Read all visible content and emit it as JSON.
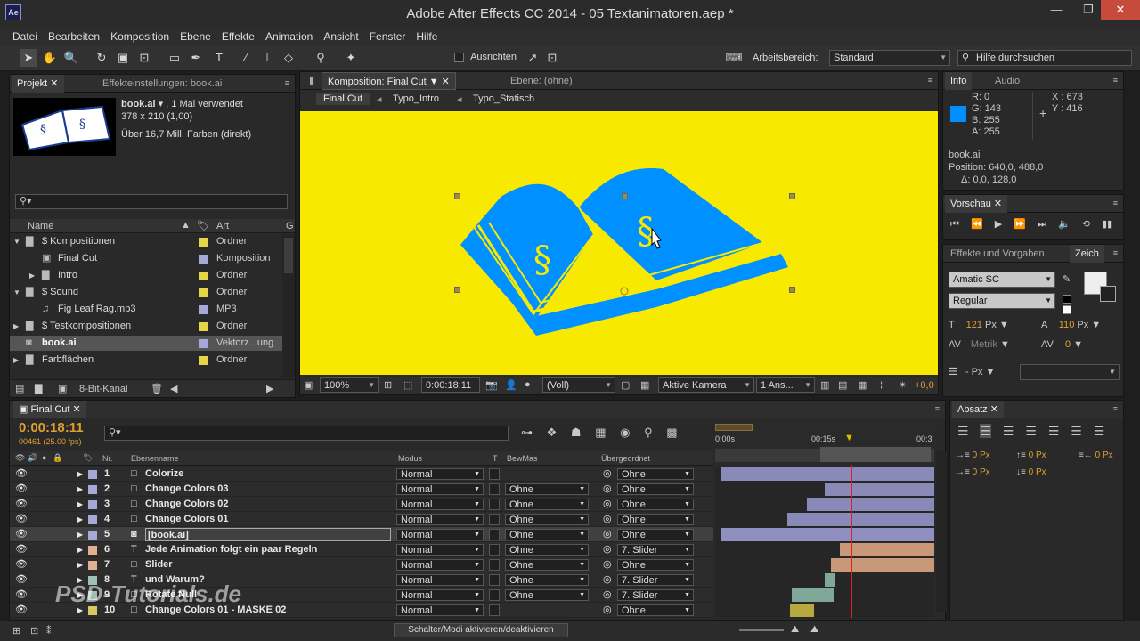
{
  "app": {
    "title": "Adobe After Effects CC 2014 - 05 Textanimatoren.aep *",
    "icon_text": "Ae"
  },
  "menu": [
    "Datei",
    "Bearbeiten",
    "Komposition",
    "Ebene",
    "Effekte",
    "Animation",
    "Ansicht",
    "Fenster",
    "Hilfe"
  ],
  "toolbar": {
    "snap_label": "Ausrichten",
    "workspace_label": "Arbeitsbereich:",
    "workspace_value": "Standard",
    "help_placeholder": "Hilfe durchsuchen"
  },
  "project": {
    "tab": "Projekt",
    "tab2": "Effekteinstellungen: book.ai",
    "item_name": "book.ai",
    "item_usage": ", 1 Mal verwendet",
    "item_size": "378 x 210 (1,00)",
    "item_colors": "Über 16,7 Mill. Farben (direkt)",
    "col_name": "Name",
    "col_type": "Art",
    "items": [
      {
        "indent": 0,
        "arrow": "▼",
        "icon": "folder",
        "name": "$ Kompositionen",
        "type": "Ordner",
        "sel": false
      },
      {
        "indent": 1,
        "arrow": "",
        "icon": "comp",
        "name": "Final Cut",
        "type": "Komposition",
        "sel": false
      },
      {
        "indent": 1,
        "arrow": "▶",
        "icon": "folder",
        "name": "Intro",
        "type": "Ordner",
        "sel": false
      },
      {
        "indent": 0,
        "arrow": "▼",
        "icon": "folder",
        "name": "$ Sound",
        "type": "Ordner",
        "sel": false
      },
      {
        "indent": 1,
        "arrow": "",
        "icon": "audio",
        "name": "Fig Leaf Rag.mp3",
        "type": "MP3",
        "sel": false
      },
      {
        "indent": 0,
        "arrow": "▶",
        "icon": "folder",
        "name": "$ Testkompositionen",
        "type": "Ordner",
        "sel": false
      },
      {
        "indent": 0,
        "arrow": "",
        "icon": "ai",
        "name": "book.ai",
        "type": "Vektorz...ung",
        "sel": true
      },
      {
        "indent": 0,
        "arrow": "▶",
        "icon": "folder",
        "name": "Farbflächen",
        "type": "Ordner",
        "sel": false
      }
    ],
    "bit_depth": "8-Bit-Kanal"
  },
  "composition": {
    "tab": "Komposition: Final Cut",
    "tab2": "Ebene: (ohne)",
    "breadcrumbs": [
      "Final Cut",
      "Typo_Intro",
      "Typo_Statisch"
    ],
    "zoom": "100%",
    "timecode": "0:00:18:11",
    "resolution": "(Voll)",
    "camera": "Aktive Kamera",
    "views": "1 Ans...",
    "exposure": "+0,0",
    "bg_color": "#f8e900"
  },
  "info": {
    "tab": "Info",
    "tab2": "Audio",
    "r": "R:  0",
    "g": "G:  143",
    "b": "B:  255",
    "a": "A:  255",
    "x": "X : 673",
    "y": "Y : 416",
    "layer": "book.ai",
    "position": "Position: 640,0, 488,0",
    "delta": "Δ: 0,0, 128,0",
    "swatch": "#008fff"
  },
  "preview": {
    "tab": "Vorschau"
  },
  "effects": {
    "tab": "Effekte und Vorgaben",
    "tab2": "Zeich"
  },
  "character": {
    "font": "Amatic SC",
    "style": "Regular",
    "size": "121",
    "leading": "110",
    "unit": "Px",
    "kerning": "Metrik",
    "tracking": "0",
    "stroke_unit": "- Px"
  },
  "paragraph": {
    "tab": "Absatz",
    "values": [
      "0 Px",
      "0 Px",
      "0 Px",
      "0 Px",
      "0 Px"
    ]
  },
  "timeline": {
    "tab": "Final Cut",
    "timecode": "0:00:18:11",
    "frames": "00461 (25.00 fps)",
    "col_nr": "Nr.",
    "col_name": "Ebenenname",
    "col_mode": "Modus",
    "col_t": "T",
    "col_trkmat": "BewMas",
    "col_parent": "Übergeordnet",
    "ruler": [
      "0:00s",
      "00:15s",
      "00:3"
    ],
    "switch_label": "Schalter/Modi aktivieren/deaktivieren",
    "layers": [
      {
        "nr": "1",
        "label": "#a8a8d8",
        "icon": "solid",
        "name": "Colorize",
        "mode": "Normal",
        "trkmat": "",
        "parent": "Ohne",
        "sel": false,
        "bar_start": 0.03,
        "bar_color": "#8a8ab8"
      },
      {
        "nr": "2",
        "label": "#a8a8d8",
        "icon": "solid",
        "name": "Change Colors 03",
        "mode": "Normal",
        "trkmat": "Ohne",
        "parent": "Ohne",
        "sel": false,
        "bar_start": 0.5,
        "bar_color": "#8a8ab8"
      },
      {
        "nr": "3",
        "label": "#a8a8d8",
        "icon": "solid",
        "name": "Change Colors 02",
        "mode": "Normal",
        "trkmat": "Ohne",
        "parent": "Ohne",
        "sel": false,
        "bar_start": 0.42,
        "bar_color": "#8a8ab8"
      },
      {
        "nr": "4",
        "label": "#a8a8d8",
        "icon": "solid",
        "name": "Change Colors 01",
        "mode": "Normal",
        "trkmat": "Ohne",
        "parent": "Ohne",
        "sel": false,
        "bar_start": 0.33,
        "bar_color": "#8a8ab8"
      },
      {
        "nr": "5",
        "label": "#a8a8d8",
        "icon": "ai",
        "name": "[book.ai]",
        "mode": "Normal",
        "trkmat": "Ohne",
        "parent": "Ohne",
        "sel": true,
        "bar_start": 0.03,
        "bar_color": "#9090c0"
      },
      {
        "nr": "6",
        "label": "#e0b090",
        "icon": "text",
        "name": "Jede Animation folgt ein paar Regeln",
        "mode": "Normal",
        "trkmat": "Ohne",
        "parent": "7. Slider",
        "sel": false,
        "bar_start": 0.57,
        "bar_color": "#c89878"
      },
      {
        "nr": "7",
        "label": "#e0b090",
        "icon": "solid",
        "name": "Slider",
        "mode": "Normal",
        "trkmat": "Ohne",
        "parent": "Ohne",
        "sel": false,
        "bar_start": 0.53,
        "bar_color": "#c89878"
      },
      {
        "nr": "8",
        "label": "#9fc0b0",
        "icon": "text",
        "name": "und Warum?",
        "mode": "Normal",
        "trkmat": "Ohne",
        "parent": "7. Slider",
        "sel": false,
        "bar_start": 0.5,
        "bar_end": 0.55,
        "bar_color": "#7fa898"
      },
      {
        "nr": "9",
        "label": "#9fc0b0",
        "icon": "solid",
        "name": "Rotate Null",
        "mode": "Normal",
        "trkmat": "Ohne",
        "parent": "7. Slider",
        "sel": false,
        "bar_start": 0.35,
        "bar_end": 0.54,
        "bar_color": "#7fa898"
      },
      {
        "nr": "10",
        "label": "#d8c860",
        "icon": "solid",
        "name": "Change Colors 01 - MASKE 02",
        "mode": "Normal",
        "trkmat": "",
        "parent": "Ohne",
        "sel": false,
        "bar_start": 0.34,
        "bar_end": 0.45,
        "bar_color": "#b8a840"
      }
    ]
  },
  "watermark": "PSD-Tutorials.de"
}
